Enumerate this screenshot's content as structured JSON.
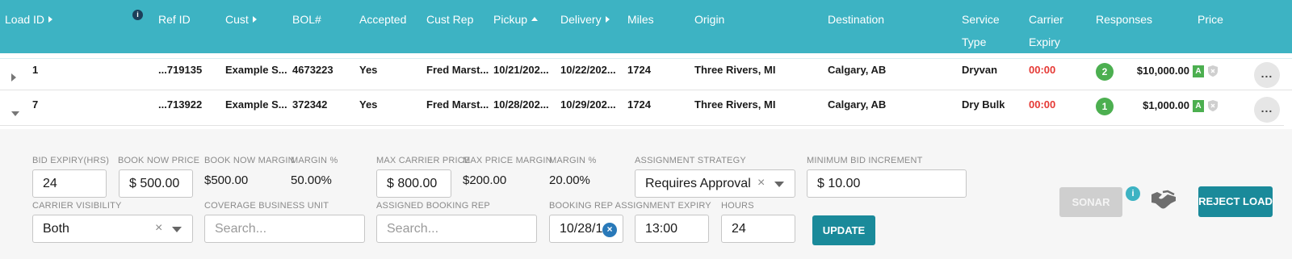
{
  "header": {
    "load_id": "Load ID",
    "info_icon": "info-icon",
    "ref_id": "Ref ID",
    "cust": "Cust",
    "bol": "BOL#",
    "accepted": "Accepted",
    "cust_rep": "Cust Rep",
    "pickup": "Pickup",
    "delivery": "Delivery",
    "miles": "Miles",
    "origin": "Origin",
    "destination": "Destination",
    "service_type": "Service Type",
    "carrier_expiry": "Carrier Expiry",
    "responses": "Responses",
    "price": "Price"
  },
  "rows": [
    {
      "load_id": "1",
      "ref_id": "...719135",
      "cust": "Example S...",
      "bol": "4673223",
      "accepted": "Yes",
      "cust_rep": "Fred Marst...",
      "pickup": "10/21/202...",
      "delivery": "10/22/202...",
      "miles": "1724",
      "origin": "Three Rivers, MI",
      "destination": "Calgary, AB",
      "service_type": "Dryvan",
      "carrier_expiry": "00:00",
      "responses": "2",
      "price": "$10,000.00",
      "price_badge": "A",
      "more": "..."
    },
    {
      "load_id": "7",
      "ref_id": "...713922",
      "cust": "Example S...",
      "bol": "372342",
      "accepted": "Yes",
      "cust_rep": "Fred Marst...",
      "pickup": "10/28/202...",
      "delivery": "10/29/202...",
      "miles": "1724",
      "origin": "Three Rivers, MI",
      "destination": "Calgary, AB",
      "service_type": "Dry Bulk",
      "carrier_expiry": "00:00",
      "responses": "1",
      "price": "$1,000.00",
      "price_badge": "A",
      "more": "..."
    }
  ],
  "detail": {
    "bid_expiry_label": "BID EXPIRY(HRS)",
    "bid_expiry_value": "24",
    "book_now_price_label": "BOOK NOW PRICE",
    "book_now_price_value": "$ 500.00",
    "book_now_margin_label": "BOOK NOW MARGIN",
    "book_now_margin_value": "$500.00",
    "margin_pct_label": "MARGIN %",
    "margin_pct_value": "50.00%",
    "max_carrier_price_label": "MAX CARRIER PRICE",
    "max_carrier_price_value": "$ 800.00",
    "max_price_margin_label": "MAX PRICE MARGIN",
    "max_price_margin_value": "$200.00",
    "margin_pct2_label": "MARGIN %",
    "margin_pct2_value": "20.00%",
    "assignment_strategy_label": "ASSIGNMENT STRATEGY",
    "assignment_strategy_value": "Requires Approval",
    "min_bid_increment_label": "MINIMUM BID INCREMENT",
    "min_bid_increment_value": "$ 10.00",
    "carrier_visibility_label": "CARRIER VISIBILITY",
    "carrier_visibility_value": "Both",
    "coverage_bu_label": "COVERAGE BUSINESS UNIT",
    "coverage_bu_placeholder": "Search...",
    "assigned_booking_rep_label": "ASSIGNED BOOKING REP",
    "assigned_booking_rep_placeholder": "Search...",
    "booking_rep_expiry_label": "BOOKING REP ASSIGNMENT EXPIRY",
    "booking_rep_expiry_date": "10/28/1",
    "booking_rep_expiry_time": "13:00",
    "hours_label": "HOURS",
    "hours_value": "24",
    "update_button": "UPDATE",
    "sonar_button": "SONAR",
    "reject_button": "REJECT LOAD",
    "clear_glyph": "×"
  }
}
